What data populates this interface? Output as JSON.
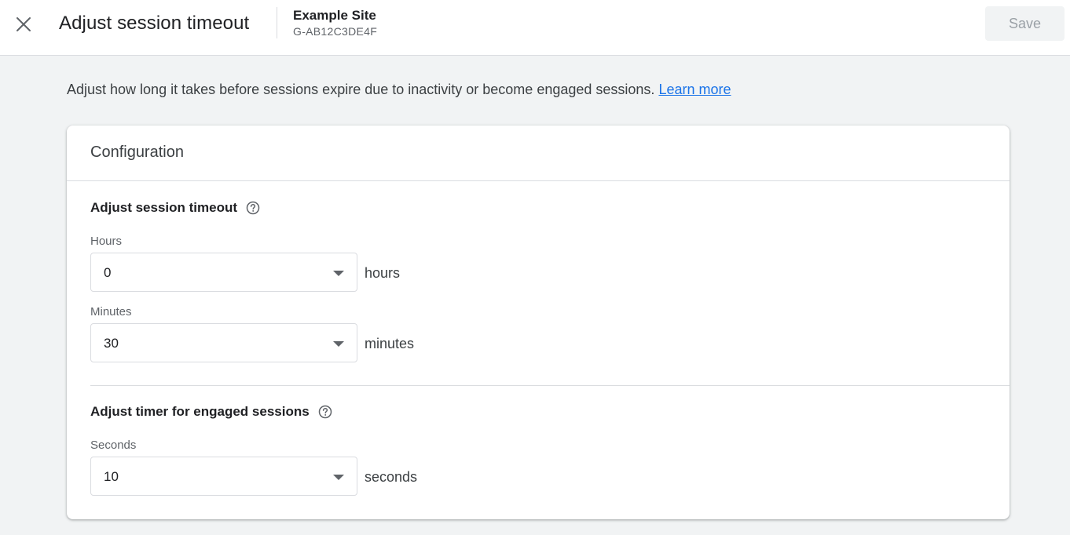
{
  "header": {
    "title": "Adjust session timeout",
    "property_name": "Example Site",
    "property_id": "G-AB12C3DE4F",
    "save_label": "Save",
    "close_icon": "close-icon"
  },
  "intro": {
    "text": "Adjust how long it takes before sessions expire due to inactivity or become engaged sessions.",
    "link_label": "Learn more"
  },
  "configuration": {
    "title": "Configuration",
    "session_timeout": {
      "title": "Adjust session timeout",
      "help_icon": "help-circle-icon",
      "hours": {
        "label": "Hours",
        "value": "0",
        "unit": "hours"
      },
      "minutes": {
        "label": "Minutes",
        "value": "30",
        "unit": "minutes"
      }
    },
    "engaged_sessions": {
      "title": "Adjust timer for engaged sessions",
      "help_icon": "help-circle-icon",
      "seconds": {
        "label": "Seconds",
        "value": "10",
        "unit": "seconds"
      }
    }
  },
  "colors": {
    "link": "#1a73e8",
    "background": "#f1f3f4",
    "save_disabled_text": "#9aa0a6"
  }
}
